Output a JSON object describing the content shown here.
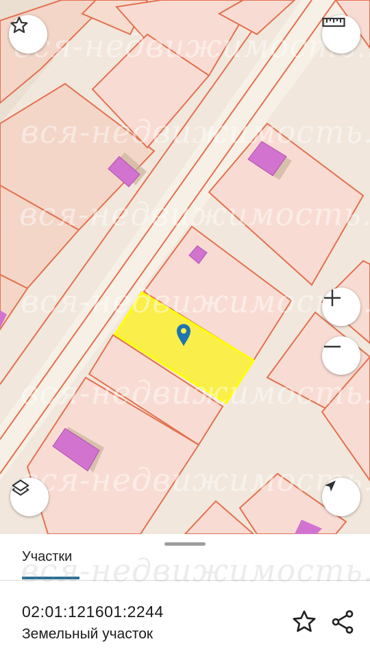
{
  "map": {
    "watermark_text": "вся-недвижимость.net",
    "colors": {
      "background": "#f1e7dc",
      "parcel_fill": "#f8dcd3",
      "parcel_border": "#e3704f",
      "building": "#d273d0",
      "road": "#f6f0e6",
      "selected_parcel": "#f9ee4a",
      "selected_border": "#ffff00",
      "marker": "#1f73b0"
    }
  },
  "controls": {
    "favorite_icon": "star-outline-icon",
    "ruler_icon": "ruler-icon",
    "zoom_in_icon": "plus-icon",
    "zoom_out_icon": "minus-icon",
    "layers_icon": "layers-icon",
    "locate_icon": "navigation-arrow-icon"
  },
  "sheet": {
    "tab_label": "Участки",
    "cadastral_number": "02:01:121601:2244",
    "object_type": "Земельный участок",
    "favorite_icon": "star-outline-icon",
    "share_icon": "share-icon"
  }
}
